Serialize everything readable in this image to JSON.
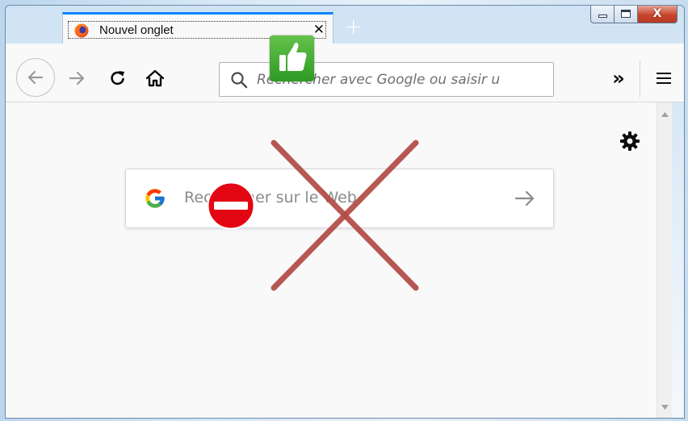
{
  "tab": {
    "title": "Nouvel onglet",
    "close_glyph": "✕",
    "favicon": "firefox-icon"
  },
  "newtab": {
    "glyph": "+"
  },
  "window_controls": {
    "close_glyph": "X",
    "minimize": "minimize-icon",
    "maximize": "maximize-icon"
  },
  "toolbar": {
    "overflow_glyph": "»",
    "back": "back-arrow-icon",
    "forward": "forward-arrow-icon",
    "reload": "reload-icon",
    "home": "home-icon",
    "menu": "hamburger-menu-icon"
  },
  "urlbar": {
    "placeholder": "Rechercher avec Google ou saisir u"
  },
  "content": {
    "search_placeholder": "Rechercher sur le Web",
    "engine_logo": "google-g-logo"
  },
  "overlays": {
    "thumbs_up": "thumbs-up-icon",
    "no_entry": "no-entry-icon",
    "red_cross": "red-x-icon"
  },
  "colors": {
    "tab_accent": "#0a84ff",
    "thumbs_green": "#3aa32b",
    "no_entry_red": "#e30613",
    "cross_red": "#b14a45",
    "close_red": "#c7452c"
  }
}
